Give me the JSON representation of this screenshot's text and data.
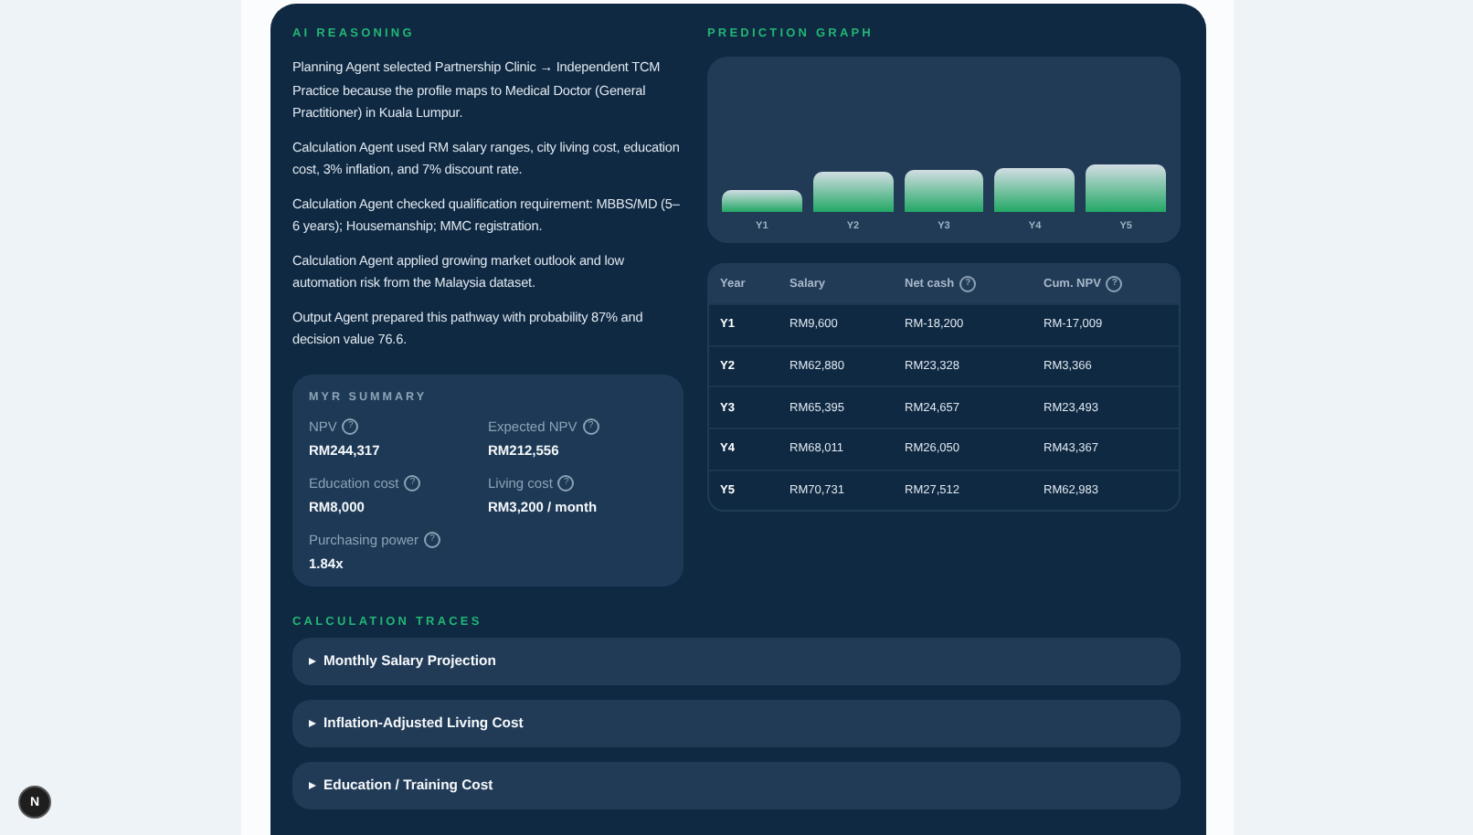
{
  "reasoning": {
    "title": "AI REASONING",
    "paragraphs": [
      "Planning Agent selected Partnership Clinic → Independent TCM Practice because the profile maps to Medical Doctor (General Practitioner) in Kuala Lumpur.",
      "Calculation Agent used RM salary ranges, city living cost, education cost, 3% inflation, and 7% discount rate.",
      "Calculation Agent checked qualification requirement: MBBS/MD (5–6 years); Housemanship; MMC registration.",
      "Calculation Agent applied growing market outlook and low automation risk from the Malaysia dataset.",
      "Output Agent prepared this pathway with probability 87% and decision value 76.6."
    ]
  },
  "summary": {
    "title": "MYR SUMMARY",
    "items": [
      {
        "label": "NPV",
        "help": "?",
        "value": "RM244,317"
      },
      {
        "label": "Expected NPV",
        "help": "?",
        "value": "RM212,556"
      },
      {
        "label": "Education cost",
        "help": "?",
        "value": "RM8,000"
      },
      {
        "label": "Living cost",
        "help": "?",
        "value": "RM3,200 / month"
      },
      {
        "label": "Purchasing power",
        "help": "?",
        "value": "1.84x"
      }
    ]
  },
  "graph": {
    "title": "PREDICTION GRAPH",
    "bars": [
      {
        "label": "Y1"
      },
      {
        "label": "Y2"
      },
      {
        "label": "Y3"
      },
      {
        "label": "Y4"
      },
      {
        "label": "Y5"
      }
    ]
  },
  "table": {
    "columns": [
      {
        "label": "Year"
      },
      {
        "label": "Salary"
      },
      {
        "label": "Net cash",
        "help": "?"
      },
      {
        "label": "Cum. NPV",
        "help": "?"
      }
    ],
    "rows": [
      [
        "Y1",
        "RM9,600",
        "RM-18,200",
        "RM-17,009"
      ],
      [
        "Y2",
        "RM62,880",
        "RM23,328",
        "RM3,366"
      ],
      [
        "Y3",
        "RM65,395",
        "RM24,657",
        "RM23,493"
      ],
      [
        "Y4",
        "RM68,011",
        "RM26,050",
        "RM43,367"
      ],
      [
        "Y5",
        "RM70,731",
        "RM27,512",
        "RM62,983"
      ]
    ]
  },
  "traces": {
    "title": "CALCULATION TRACES",
    "items": [
      {
        "label": "Monthly Salary Projection",
        "expanded": false
      },
      {
        "label": "Inflation-Adjusted Living Cost",
        "expanded": false
      },
      {
        "label": "Education / Training Cost",
        "expanded": false
      }
    ]
  },
  "dev_badge": "N"
}
